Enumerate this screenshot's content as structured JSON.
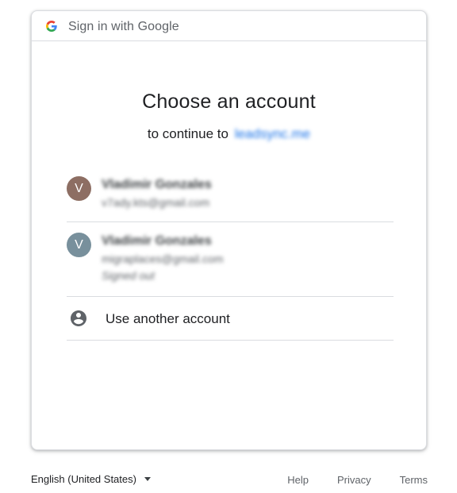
{
  "header": {
    "text": "Sign in with Google",
    "logo_icon": "google-g-icon",
    "logo_colors": [
      "#4285f4",
      "#ea4335",
      "#fbbc05",
      "#34a853"
    ]
  },
  "main": {
    "title": "Choose an account",
    "subtitle_prefix": "to continue to",
    "subtitle_link": "leadsync.me"
  },
  "accounts": [
    {
      "initial": "V",
      "name": "Vladimir Gonzales",
      "email": "v7ady.kts@gmail.com",
      "status": "",
      "avatar_color": "#8d6e63"
    },
    {
      "initial": "V",
      "name": "Vladimir Gonzales",
      "email": "migraplaces@gmail.com",
      "status": "Signed out",
      "avatar_color": "#78909c"
    }
  ],
  "another_account": {
    "label": "Use another account",
    "icon": "account-circle-icon"
  },
  "footer": {
    "language": "English (United States)",
    "help": "Help",
    "privacy": "Privacy",
    "terms": "Terms"
  },
  "colors": {
    "link": "#1a73e8",
    "divider": "#dadce0",
    "text_primary": "#202124",
    "text_secondary": "#5f6368"
  }
}
